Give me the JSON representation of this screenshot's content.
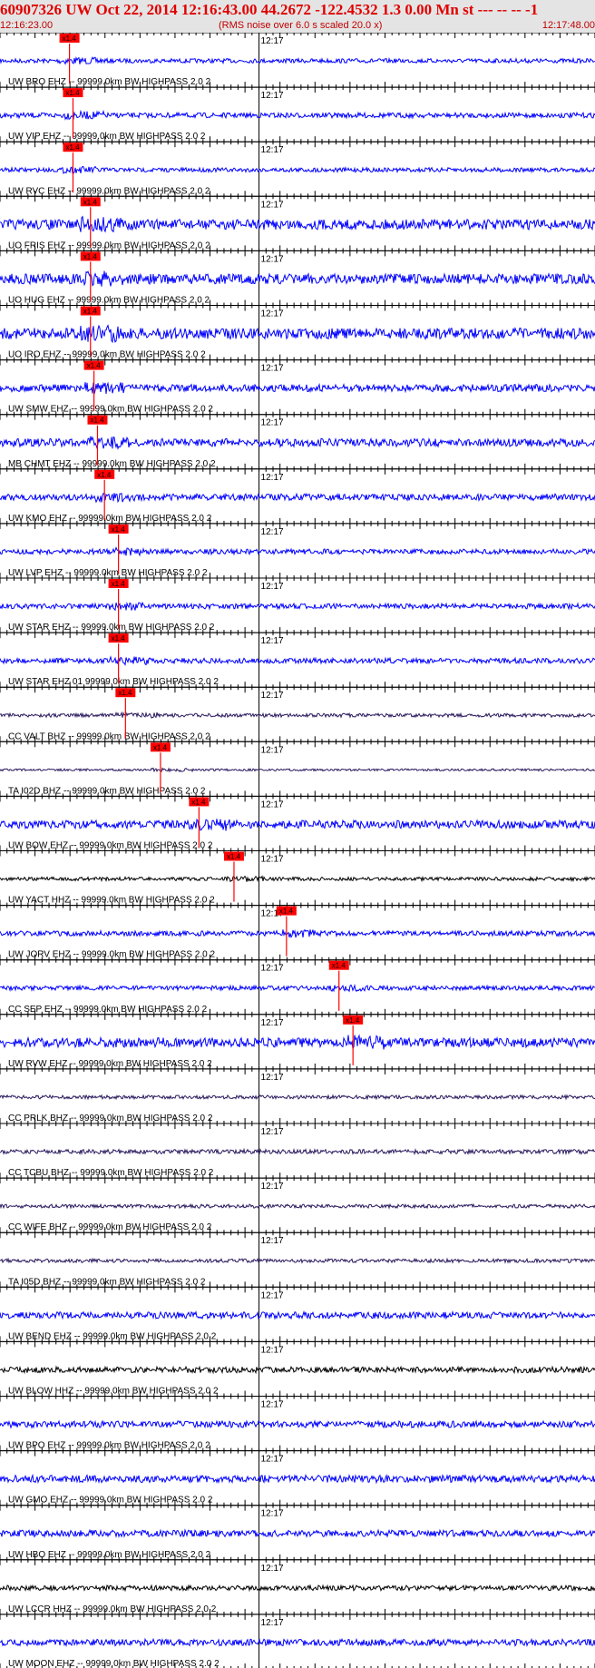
{
  "header": {
    "title": "60907326 UW Oct 22, 2014 12:16:43.00   44.2672 -122.4532  1.3 0.00 Mn st --- -- --  -1",
    "start_time": "12:16:23.00",
    "end_time": "12:17:48.00",
    "note": "(RMS noise over 6.0 s scaled 20.0 x)"
  },
  "chart_data": {
    "type": "line",
    "x_start": "12:16:23.00",
    "x_end": "12:17:48.00",
    "minute_label": "12:17",
    "pick_label": "x1.4",
    "colors": {
      "blue": "#0000ff",
      "purple": "#2a1a5e",
      "black": "#000000",
      "pick": "#ff0000"
    },
    "traces": [
      {
        "label": "UW BRO EHZ -- 99999.0km BW  HIGHPASS  2.0  2",
        "color": "blue",
        "pick_s": 8.5,
        "noise": 0.12
      },
      {
        "label": "UW VIP EHZ -- 99999.0km BW  HIGHPASS  2.0  2",
        "color": "blue",
        "pick_s": 9.0,
        "noise": 0.14
      },
      {
        "label": "UW RVC EHZ -- 99999.0km BW  HIGHPASS  2.0  2",
        "color": "blue",
        "pick_s": 9.0,
        "noise": 0.12
      },
      {
        "label": "UO FRIS EHZ -- 99999.0km BW  HIGHPASS  2.0  2",
        "color": "blue",
        "pick_s": 11.5,
        "noise": 0.28
      },
      {
        "label": "UO HUG EHZ -- 99999.0km BW  HIGHPASS  2.0  2",
        "color": "blue",
        "pick_s": 11.5,
        "noise": 0.28
      },
      {
        "label": "UO IRO EHZ -- 99999.0km BW  HIGHPASS  2.0  2",
        "color": "blue",
        "pick_s": 11.5,
        "noise": 0.3
      },
      {
        "label": "UW SMW EHZ -- 99999.0km BW  HIGHPASS  2.0  2",
        "color": "blue",
        "pick_s": 12.0,
        "noise": 0.2
      },
      {
        "label": "MB CHMT EHZ -- 99999.0km BW  HIGHPASS  2.0  2",
        "color": "blue",
        "pick_s": 12.5,
        "noise": 0.22
      },
      {
        "label": "UW KMO EHZ -- 99999.0km BW  HIGHPASS  2.0  2",
        "color": "blue",
        "pick_s": 13.5,
        "noise": 0.18
      },
      {
        "label": "UW LVP EHZ -- 99999.0km BW  HIGHPASS  2.0  2",
        "color": "blue",
        "pick_s": 15.5,
        "noise": 0.14
      },
      {
        "label": "UW STAR EHZ -- 99999.0km BW  HIGHPASS  2.0  2",
        "color": "blue",
        "pick_s": 15.5,
        "noise": 0.14
      },
      {
        "label": "UW STAR EHZ 01 99999.0km BW  HIGHPASS  2.0  2",
        "color": "blue",
        "pick_s": 15.5,
        "noise": 0.14
      },
      {
        "label": "CC VALT BHZ -- 99999.0km BW  HIGHPASS  2.0  2",
        "color": "purple",
        "pick_s": 16.5,
        "noise": 0.1
      },
      {
        "label": "TA I02D BHZ -- 99999.0km BW  HIGHPASS  2.0  2",
        "color": "purple",
        "pick_s": 21.5,
        "noise": 0.06
      },
      {
        "label": "UW BOW EHZ -- 99999.0km BW  HIGHPASS  2.0  2",
        "color": "blue",
        "pick_s": 27.0,
        "noise": 0.22
      },
      {
        "label": "UW YACT HHZ -- 99999.0km BW  HIGHPASS  2.0  2",
        "color": "black",
        "pick_s": 32.0,
        "noise": 0.1
      },
      {
        "label": "UW JORV EHZ -- 99999.0km BW  HIGHPASS  2.0  2",
        "color": "blue",
        "pick_s": 39.5,
        "noise": 0.14
      },
      {
        "label": "CC SEP EHZ -- 99999.0km BW  HIGHPASS  2.0  2",
        "color": "blue",
        "pick_s": 47.0,
        "noise": 0.12
      },
      {
        "label": "UW RVW EHZ -- 99999.0km BW  HIGHPASS  2.0  2",
        "color": "blue",
        "pick_s": 49.0,
        "noise": 0.26
      },
      {
        "label": "CC PRLK BHZ -- 99999.0km BW  HIGHPASS  2.0  2",
        "color": "purple",
        "pick_s": null,
        "noise": 0.1
      },
      {
        "label": "CC TCBU BHZ -- 99999.0km BW  HIGHPASS  2.0  2",
        "color": "purple",
        "pick_s": null,
        "noise": 0.12
      },
      {
        "label": "CC WIFE BHZ -- 99999.0km BW  HIGHPASS  2.0  2",
        "color": "purple",
        "pick_s": null,
        "noise": 0.1
      },
      {
        "label": "TA I05D BHZ -- 99999.0km BW  HIGHPASS  2.0  2",
        "color": "purple",
        "pick_s": null,
        "noise": 0.1
      },
      {
        "label": "UW BEND EHZ -- 99999.0km BW  HIGHPASS  2.0  2",
        "color": "blue",
        "pick_s": null,
        "noise": 0.18
      },
      {
        "label": "UW BLOW HHZ -- 99999.0km BW  HIGHPASS  2.0  2",
        "color": "black",
        "pick_s": null,
        "noise": 0.16
      },
      {
        "label": "UW BPO EHZ -- 99999.0km BW  HIGHPASS  2.0  2",
        "color": "blue",
        "pick_s": null,
        "noise": 0.18
      },
      {
        "label": "UW GMO EHZ -- 99999.0km BW  HIGHPASS  2.0  2",
        "color": "blue",
        "pick_s": null,
        "noise": 0.2
      },
      {
        "label": "UW HBO EHZ -- 99999.0km BW  HIGHPASS  2.0  2",
        "color": "blue",
        "pick_s": null,
        "noise": 0.18
      },
      {
        "label": "UW LCCR HHZ -- 99999.0km BW  HIGHPASS  2.0  2",
        "color": "black",
        "pick_s": null,
        "noise": 0.14
      },
      {
        "label": "UW MOON EHZ -- 99999.0km BW  HIGHPASS  2.0  2",
        "color": "blue",
        "pick_s": null,
        "noise": 0.18
      }
    ]
  }
}
